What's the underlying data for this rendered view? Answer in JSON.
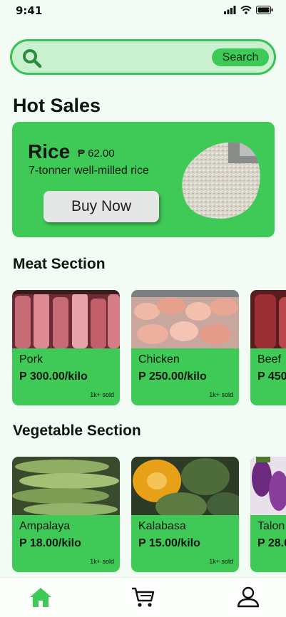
{
  "status_bar": {
    "time": "9:41"
  },
  "search": {
    "placeholder": "",
    "button_label": "Search"
  },
  "hot_sales": {
    "title": "Hot Sales",
    "product": {
      "name": "Rice",
      "price": "₱ 62.00",
      "description": "7-tonner well-milled rice",
      "button_label": "Buy Now"
    }
  },
  "meat_section": {
    "title": "Meat Section",
    "items": [
      {
        "name": "Pork",
        "price": "P 300.00/kilo",
        "sold": "1k+ sold"
      },
      {
        "name": "Chicken",
        "price": "P 250.00/kilo",
        "sold": "1k+ sold"
      },
      {
        "name": "Beef",
        "price": "P 450",
        "sold": ""
      }
    ]
  },
  "vegetable_section": {
    "title": "Vegetable Section",
    "items": [
      {
        "name": "Ampalaya",
        "price": "P 18.00/kilo",
        "sold": "1k+ sold"
      },
      {
        "name": "Kalabasa",
        "price": "P 15.00/kilo",
        "sold": "1k+ sold"
      },
      {
        "name": "Talon",
        "price": "P 28.0",
        "sold": ""
      }
    ]
  },
  "bottom_nav": [
    "home-icon",
    "cart-icon",
    "profile-icon"
  ],
  "colors": {
    "accent": "#3fca58",
    "background": "#f2fbf4",
    "search_bg": "#c9f0cf"
  }
}
